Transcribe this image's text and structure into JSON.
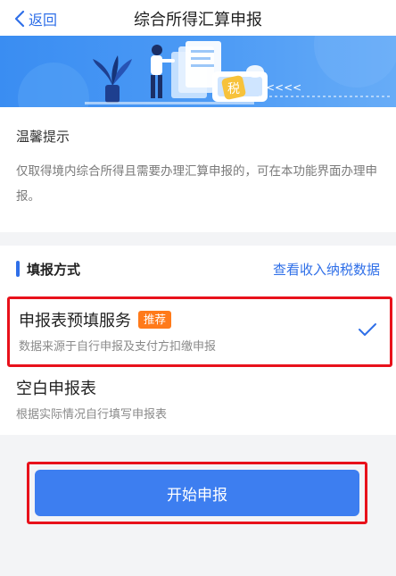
{
  "nav": {
    "back_label": "返回",
    "title": "综合所得汇算申报"
  },
  "banner": {
    "tax_char": "税",
    "arrows": "<<<<"
  },
  "tip": {
    "title": "温馨提示",
    "body": "仅取得境内综合所得且需要办理汇算申报的，可在本功能界面办理申报。"
  },
  "method": {
    "title": "填报方式",
    "link": "查看收入纳税数据",
    "options": [
      {
        "title": "申报表预填服务",
        "badge": "推荐",
        "subtitle": "数据来源于自行申报及支付方扣缴申报",
        "selected": true
      },
      {
        "title": "空白申报表",
        "subtitle": "根据实际情况自行填写申报表",
        "selected": false
      }
    ]
  },
  "actions": {
    "start_label": "开始申报"
  },
  "colors": {
    "accent": "#2f6fe8",
    "button": "#3d7ef0",
    "badge": "#ff7a1a",
    "highlight": "#e8111b"
  }
}
